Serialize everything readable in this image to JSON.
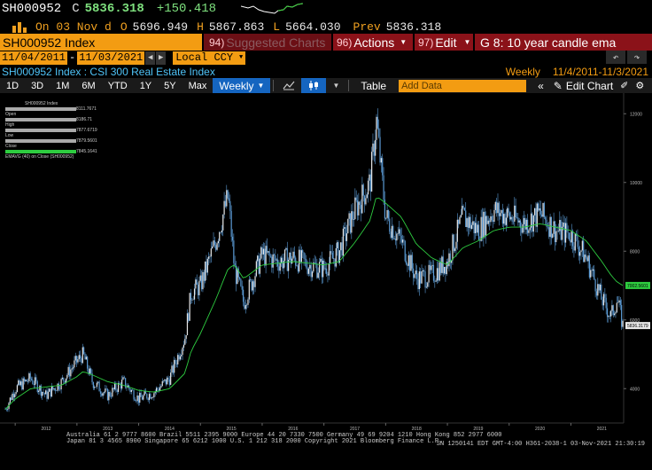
{
  "quote": {
    "ticker": "SH000952",
    "close_prefix": "C",
    "last_price": "5836.318",
    "change": "+150.418"
  },
  "ohlc": {
    "on_label": "On 03 Nov d",
    "open_label": "O",
    "open": "5696.949",
    "high_label": "H",
    "high": "5867.863",
    "low_label": "L",
    "low": "5664.030",
    "prev_label": "Prev",
    "prev": "5836.318"
  },
  "header": {
    "security": "SH000952 Index",
    "suggested_num": "94)",
    "suggested": "Suggested Charts",
    "actions_num": "96)",
    "actions": "Actions",
    "edit_num": "97)",
    "edit": "Edit",
    "graph": "G 8: 10 year candle ema"
  },
  "dates": {
    "start": "11/04/2011",
    "end": "11/03/2021",
    "currency": "Local CCY"
  },
  "title_row": {
    "title": "SH000952 Index : CSI 300 Real Estate Index",
    "period": "Weekly",
    "range": "11/4/2011-11/3/2021"
  },
  "toolbar": {
    "periods": [
      "1D",
      "3D",
      "1M",
      "6M",
      "YTD",
      "1Y",
      "5Y",
      "Max"
    ],
    "frequency": "Weekly",
    "table": "Table",
    "add_data_placeholder": "Add Data",
    "edit_chart": "Edit Chart"
  },
  "legend": {
    "title": "SH000952 Index",
    "items": [
      {
        "label": "Open",
        "value": "8111.7671"
      },
      {
        "label": "High",
        "value": "8186.71"
      },
      {
        "label": "Low",
        "value": "7877.6719"
      },
      {
        "label": "Close",
        "value": "7879.5601"
      },
      {
        "label": "EMAVG (40) on Close (SH000952)",
        "value": "7845.1641"
      }
    ]
  },
  "chart_data": {
    "type": "line",
    "title": "SH000952 Index : CSI 300 Real Estate Index",
    "frequency": "Weekly",
    "x_tick_labels": [
      "2012",
      "2013",
      "2014",
      "2015",
      "2016",
      "2017",
      "2018",
      "2019",
      "2020",
      "2021"
    ],
    "y_tick_labels": [
      "4000",
      "6000",
      "8000",
      "10000",
      "12000"
    ],
    "ylim": [
      3000,
      12600
    ],
    "grid": false,
    "x": [
      2011.84,
      2012.0,
      2012.25,
      2012.5,
      2012.75,
      2013.0,
      2013.1,
      2013.25,
      2013.5,
      2013.75,
      2014.0,
      2014.25,
      2014.5,
      2014.75,
      2014.85,
      2015.0,
      2015.25,
      2015.45,
      2015.55,
      2015.7,
      2016.0,
      2016.25,
      2016.5,
      2016.75,
      2017.0,
      2017.25,
      2017.5,
      2017.75,
      2017.85,
      2018.0,
      2018.25,
      2018.5,
      2018.75,
      2019.0,
      2019.25,
      2019.5,
      2019.75,
      2020.0,
      2020.25,
      2020.5,
      2020.75,
      2021.0,
      2021.25,
      2021.5,
      2021.65,
      2021.75,
      2021.84
    ],
    "series": [
      {
        "values": [
          3400,
          4000,
          4300,
          3800,
          4200,
          4800,
          5000,
          4200,
          3800,
          4200,
          3700,
          3900,
          4300,
          5500,
          6800,
          7000,
          8300,
          9600,
          7500,
          6500,
          7900,
          7700,
          7800,
          7600,
          7500,
          8000,
          9200,
          10000,
          11800,
          9000,
          8300,
          7200,
          7300,
          7700,
          9000,
          8600,
          9200,
          9000,
          8800,
          9100,
          8600,
          8500,
          7800,
          6600,
          6100,
          6600,
          5836
        ]
      },
      {
        "name": "EMAVG (40) on Close (SH000952)",
        "values": [
          3400,
          3700,
          4000,
          4050,
          4100,
          4350,
          4500,
          4400,
          4200,
          4100,
          3950,
          3900,
          4000,
          4450,
          5100,
          5600,
          6600,
          7500,
          7600,
          7200,
          7600,
          7650,
          7700,
          7650,
          7600,
          7700,
          8250,
          8900,
          9600,
          9400,
          9000,
          8200,
          7800,
          7600,
          8100,
          8300,
          8600,
          8700,
          8700,
          8800,
          8700,
          8600,
          8300,
          7700,
          7300,
          7100,
          7002
        ]
      }
    ],
    "last_price_label": "5836.3179",
    "ema_label": "7002.5601"
  },
  "footer": {
    "line1": "Australia 61 2 9777 8600  Brazil 5511 2395 9000  Europe 44 20 7330 7500  Germany 49 69 9204 1210  Hong Kong 852 2977 6000",
    "line2": "Japan 81 3 4565 8900        Singapore 65 6212 1000        U.S. 1 212 318 2000        Copyright 2021 Bloomberg Finance L.P.",
    "line3": "SN 1250141 EDT  GMT-4:00 H361-2038-1 03-Nov-2021 21:30:19"
  },
  "colors": {
    "orange": "#f39c12",
    "green": "#33cc33",
    "candle": "#5b9bd5",
    "ema": "#2ecc40"
  }
}
